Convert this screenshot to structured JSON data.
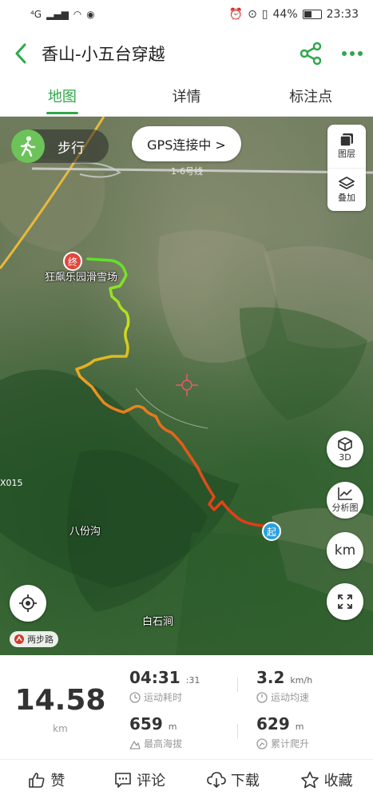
{
  "status_bar": {
    "signal": "⁴G",
    "battery": "44%",
    "time": "23:33"
  },
  "header": {
    "title": "香山-小五台穿越"
  },
  "tabs": [
    {
      "label": "地图",
      "active": true
    },
    {
      "label": "详情",
      "active": false
    },
    {
      "label": "标注点",
      "active": false
    }
  ],
  "map": {
    "mode_label": "步行",
    "gps_status": "GPS连接中 >",
    "layers_label": "图层",
    "overlay_label": "叠加",
    "view3d_label": "3D",
    "analysis_label": "分析图",
    "unit_label": "km",
    "road_name": "1-6号线",
    "road_code": "X015",
    "places": [
      "狂飙乐园滑雪场",
      "八份沟",
      "白石涧"
    ],
    "start_label": "起",
    "end_label": "终",
    "logo_text": "两步路"
  },
  "stats": {
    "distance": "14.58",
    "distance_unit": "km",
    "duration": "04:31",
    "duration_sec": ":31",
    "duration_label": "运动耗时",
    "avg_speed": "3.2",
    "avg_speed_unit": "km/h",
    "avg_speed_label": "运动均速",
    "max_alt": "659",
    "max_alt_unit": "m",
    "max_alt_label": "最高海拔",
    "ascent": "629",
    "ascent_unit": "m",
    "ascent_label": "累计爬升"
  },
  "actions": [
    {
      "label": "赞",
      "icon": "thumbs-up-icon"
    },
    {
      "label": "评论",
      "icon": "comment-icon"
    },
    {
      "label": "下载",
      "icon": "cloud-download-icon"
    },
    {
      "label": "收藏",
      "icon": "star-icon"
    }
  ],
  "colors": {
    "accent": "#2fa84a",
    "track_start": "#8fd82c",
    "track_mid": "#f0a020",
    "track_end": "#e23a1a",
    "start_marker": "#2aa0df",
    "end_marker": "#e2463c"
  }
}
